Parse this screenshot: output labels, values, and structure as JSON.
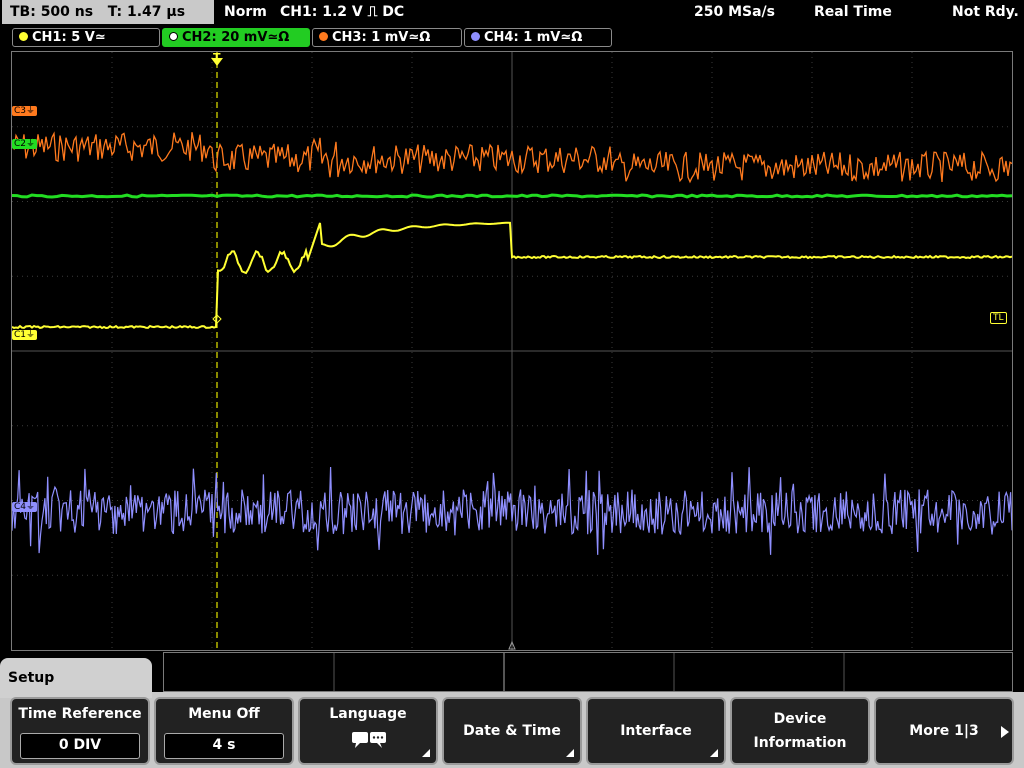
{
  "status_bar": {
    "timebase": "TB: 500 ns",
    "trigger_time": "T: 1.47 µs",
    "acq_mode": "Norm",
    "trigger_info": "CH1: 1.2 V ⎍ DC",
    "sample_rate": "250 MSa/s",
    "real_time": "Real Time",
    "ready_state": "Not Rdy."
  },
  "channels": [
    {
      "label": "CH1: 5 V≃",
      "color": "#ffff33"
    },
    {
      "label": "CH2: 20 mV≃Ω",
      "color": "#22dd22"
    },
    {
      "label": "CH3: 1 mV≃Ω",
      "color": "#ff7a1e"
    },
    {
      "label": "CH4: 1 mV≃Ω",
      "color": "#8f8fff"
    }
  ],
  "markers": {
    "c1": "C1⏚",
    "c2": "C2⏚",
    "c3": "C3⏚",
    "c4": "C4⏚",
    "tl": "TL",
    "trigger": "T"
  },
  "menu": {
    "title": "Setup",
    "time_reference": {
      "label": "Time Reference",
      "value": "0 DIV"
    },
    "menu_off": {
      "label": "Menu Off",
      "value": "4 s"
    },
    "language": {
      "label": "Language",
      "icon": "speech-bubble-icon"
    },
    "date_time": "Date & Time",
    "interface": "Interface",
    "device_info": {
      "line1": "Device",
      "line2": "Information"
    },
    "more": "More 1|3"
  }
}
